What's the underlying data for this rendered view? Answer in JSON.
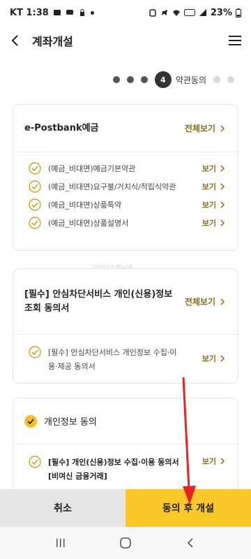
{
  "status_bar": {
    "time": "KT 1:38",
    "battery": "23%"
  },
  "header": {
    "title": "계좌개설"
  },
  "steps": {
    "current_number": "4",
    "current_label": "약관동의"
  },
  "card1": {
    "title": "e-Postbank예금",
    "view_all": "전체보기",
    "items": [
      {
        "label": "(예금_비대면)예금기본약관",
        "view": "보기"
      },
      {
        "label": "(예금_비대면)요구불/거치식/적립식약관",
        "view": "보기"
      },
      {
        "label": "(예금_비대면)상품특약",
        "view": "보기"
      },
      {
        "label": "(예금_비대면)상품설명서",
        "view": "보기"
      }
    ]
  },
  "watermark": "이웨이스웨뉴엘",
  "card2": {
    "title_line1": "[필수] 안심차단서비스 개인(신용)정보",
    "title_line2": "조회 동의서",
    "view_all": "전체보기",
    "item_line1": "[필수] 안심차단서비스 개인정보 수집·이",
    "item_line2": "용·제공 동의서",
    "item_view": "보기"
  },
  "card3": {
    "title": "개인정보 동의",
    "item_line1": "[필수] 개인(신용)정보 수집·이용 동의서",
    "item_line2": "[비여신 금융거래]",
    "item_view": "보기"
  },
  "bottom": {
    "cancel": "취소",
    "agree": "동의 후 개설"
  },
  "colors": {
    "accent": "#fbc82a",
    "link_gold": "#8a6d1a",
    "check_gold": "#c9a227",
    "annotation_red": "#e8231f"
  }
}
